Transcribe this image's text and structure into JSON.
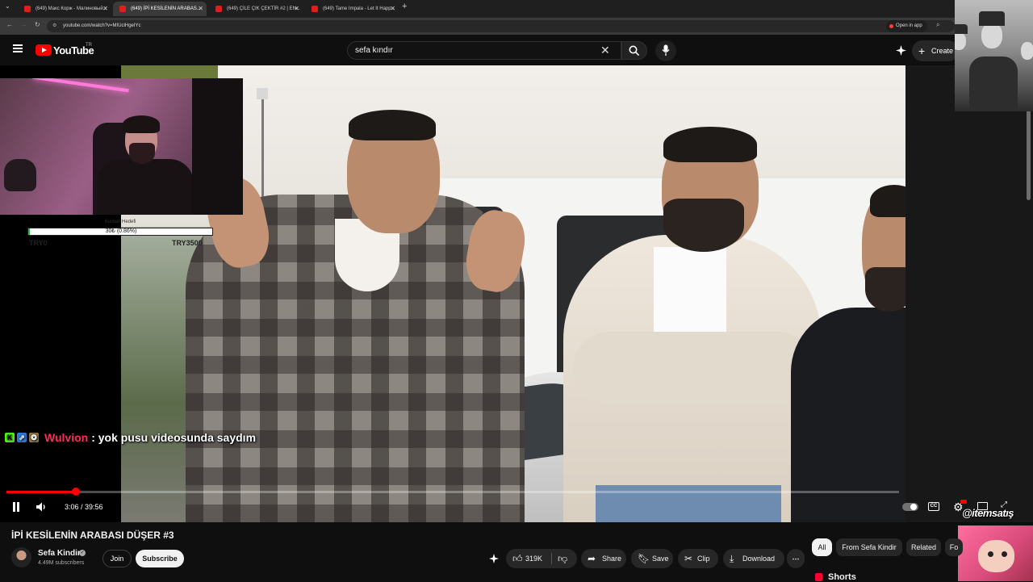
{
  "browser": {
    "tabs": [
      {
        "title": "(649) Макс Корж - Малиновый..."
      },
      {
        "title": "(649) İPİ KESİLENİN ARABAS..."
      },
      {
        "title": "(649) ÇİLE ÇIK ÇEKTİR #2 | EN..."
      },
      {
        "title": "(649) Tame Impala - Let It Happ..."
      }
    ],
    "url": "youtube.com/watch?v=MIUclHgeIYc",
    "open_in_app_label": "Open in app"
  },
  "header": {
    "logo_text": "YouTube",
    "country_code": "TR",
    "search_value": "sefa kındır",
    "create_label": "Create"
  },
  "stream_overlay": {
    "goal_label": "Kurban Hedefi",
    "goal_progress_text": "30₺ (0.86%)",
    "goal_fraction": 0.0086,
    "goal_min": "TRY0",
    "goal_max": "TRY3500",
    "chat_badges": [
      "K",
      "⇗",
      "❂"
    ],
    "chat_user": "Wulvion",
    "chat_message": ": yok pusu videosunda saydım",
    "sponsor_text": "@itemsatış"
  },
  "player": {
    "time_display": "3:06 / 39:56",
    "played_fraction": 0.0776,
    "cc_label": "CC"
  },
  "video": {
    "title": "İPİ KESİLENİN ARABASI DÜŞER #3",
    "channel_name": "Sefa Kindir",
    "subscriber_count": "4.49M subscribers",
    "join_label": "Join",
    "subscribe_label": "Subscribe",
    "like_count": "319K",
    "share_label": "Share",
    "save_label": "Save",
    "clip_label": "Clip",
    "download_label": "Download",
    "more_label": "⋯"
  },
  "sidebar": {
    "chips": [
      {
        "label": "All"
      },
      {
        "label": "From Sefa Kindir"
      },
      {
        "label": "Related"
      },
      {
        "label": "Fo"
      }
    ],
    "shorts_label": "Shorts"
  },
  "colors": {
    "accent": "#ff0000",
    "chat_user": "#ff2d55",
    "goal_fill": "#1fb84a"
  }
}
